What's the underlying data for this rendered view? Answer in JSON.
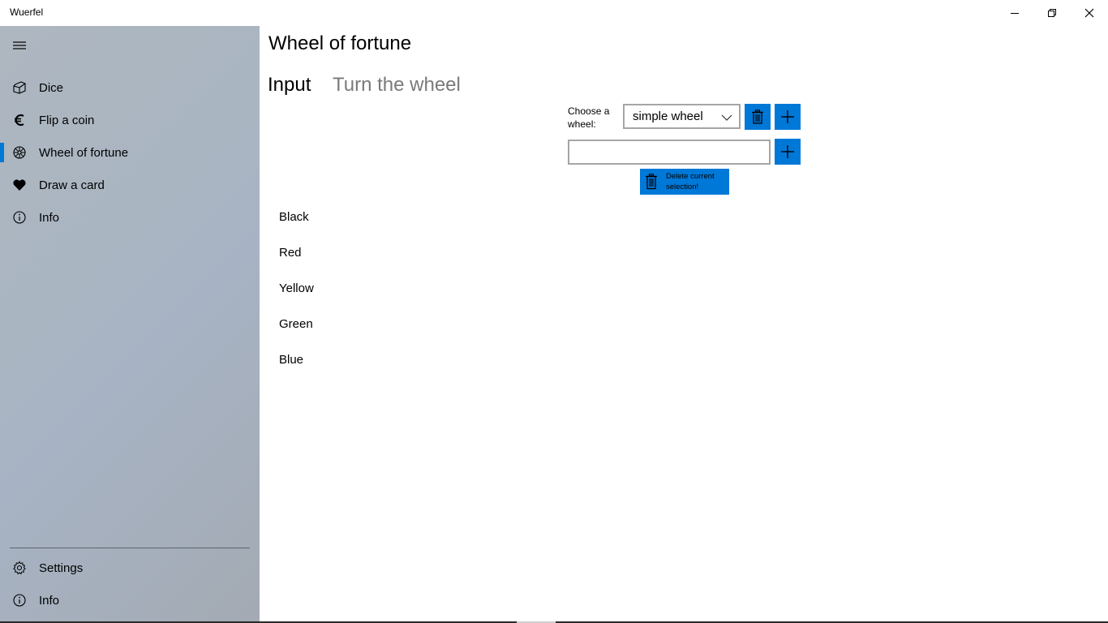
{
  "window": {
    "title": "Wuerfel",
    "minimize_icon": "minimize-icon",
    "restore_icon": "restore-icon",
    "close_icon": "close-icon"
  },
  "nav": {
    "menu_icon": "hamburger-icon",
    "items": [
      {
        "label": "Dice",
        "icon": "dice-icon"
      },
      {
        "label": "Flip a coin",
        "icon": "euro-icon"
      },
      {
        "label": "Wheel of fortune",
        "icon": "wheel-icon",
        "selected": true
      },
      {
        "label": "Draw a card",
        "icon": "heart-icon"
      },
      {
        "label": "Info",
        "icon": "info-icon"
      }
    ],
    "footer": [
      {
        "label": "Settings",
        "icon": "gear-icon"
      },
      {
        "label": "Info",
        "icon": "info-icon"
      }
    ],
    "accent": "#0078d7"
  },
  "main": {
    "title": "Wheel of fortune",
    "tabs": [
      {
        "label": "Input",
        "active": true
      },
      {
        "label": "Turn the wheel",
        "active": false
      }
    ],
    "choose_label": "Choose a wheel:",
    "wheel_select": {
      "value": "simple wheel"
    },
    "new_entry": {
      "value": "",
      "placeholder": ""
    },
    "delete_selection_label": "Delete current selection!",
    "entries": [
      "Black",
      "Red",
      "Yellow",
      "Green",
      "Blue"
    ]
  },
  "colors": {
    "accent": "#0078d7",
    "inactive_tab": "#7a7a7a"
  }
}
